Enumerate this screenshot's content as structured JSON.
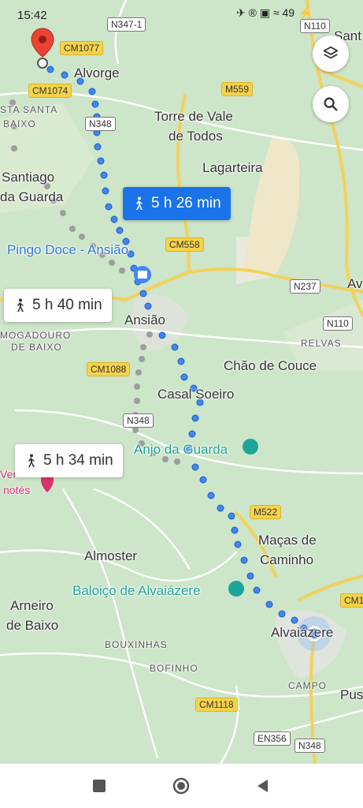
{
  "status": {
    "time": "15:42",
    "icons": "✈ ® ▣ ≈ 49 ⚡"
  },
  "map": {
    "towns": {
      "alvorge": "Alvorge",
      "santa": "STA SANTA",
      "baixo": "BAIXO",
      "santiago": "Santiago",
      "da_guarda": "da Guarda",
      "torre1": "Torre de Vale",
      "torre2": "de Todos",
      "lagarteira": "Lagarteira",
      "pingo_doce": "Pingo Doce - Ansião",
      "ansiao": "Ansião",
      "mogadouro": "MOGADOURO",
      "de_baixo": "DE BAIXO",
      "relvas": "RELVAS",
      "chao": "Chão de Couce",
      "casal": "Casal Soeiro",
      "anjo": "Anjo da Guarda",
      "ver": "Ver",
      "notes": "notés",
      "macas1": "Maças de",
      "macas2": "Caminho",
      "almoster": "Almoster",
      "baloico": "Baloiço de Alvaiázere",
      "arneiro1": "Arneiro",
      "arneiro2": "de Baixo",
      "bouxinhas": "BOUXINHAS",
      "bofinho": "BOFINHO",
      "alvaiazere": "Alvaiázere",
      "campo": "CAMPO",
      "pus": "Pus",
      "sant": "Sant",
      "av": "Av"
    },
    "roads": {
      "n347": "N347-1",
      "n110_top": "N110",
      "cm1077": "CM1077",
      "cm1074": "CM1074",
      "m559": "M559",
      "n348_a": "N348",
      "cm558": "CM558",
      "n237": "N237",
      "n110": "N110",
      "cm1088": "CM1088",
      "n348_b": "N348",
      "m522": "M522",
      "cm1": "CM1",
      "cm1118": "CM1118",
      "en356": "EN356",
      "n348_c": "N348"
    },
    "routes": {
      "selected": "5 h 26 min",
      "alt1": "5 h 40 min",
      "alt2": "5 h 34 min"
    },
    "colors": {
      "selected_route": "#4285f4",
      "alt_route": "#9e9e9e",
      "pin": "#ea4335",
      "water": "#4fa3e0"
    }
  }
}
